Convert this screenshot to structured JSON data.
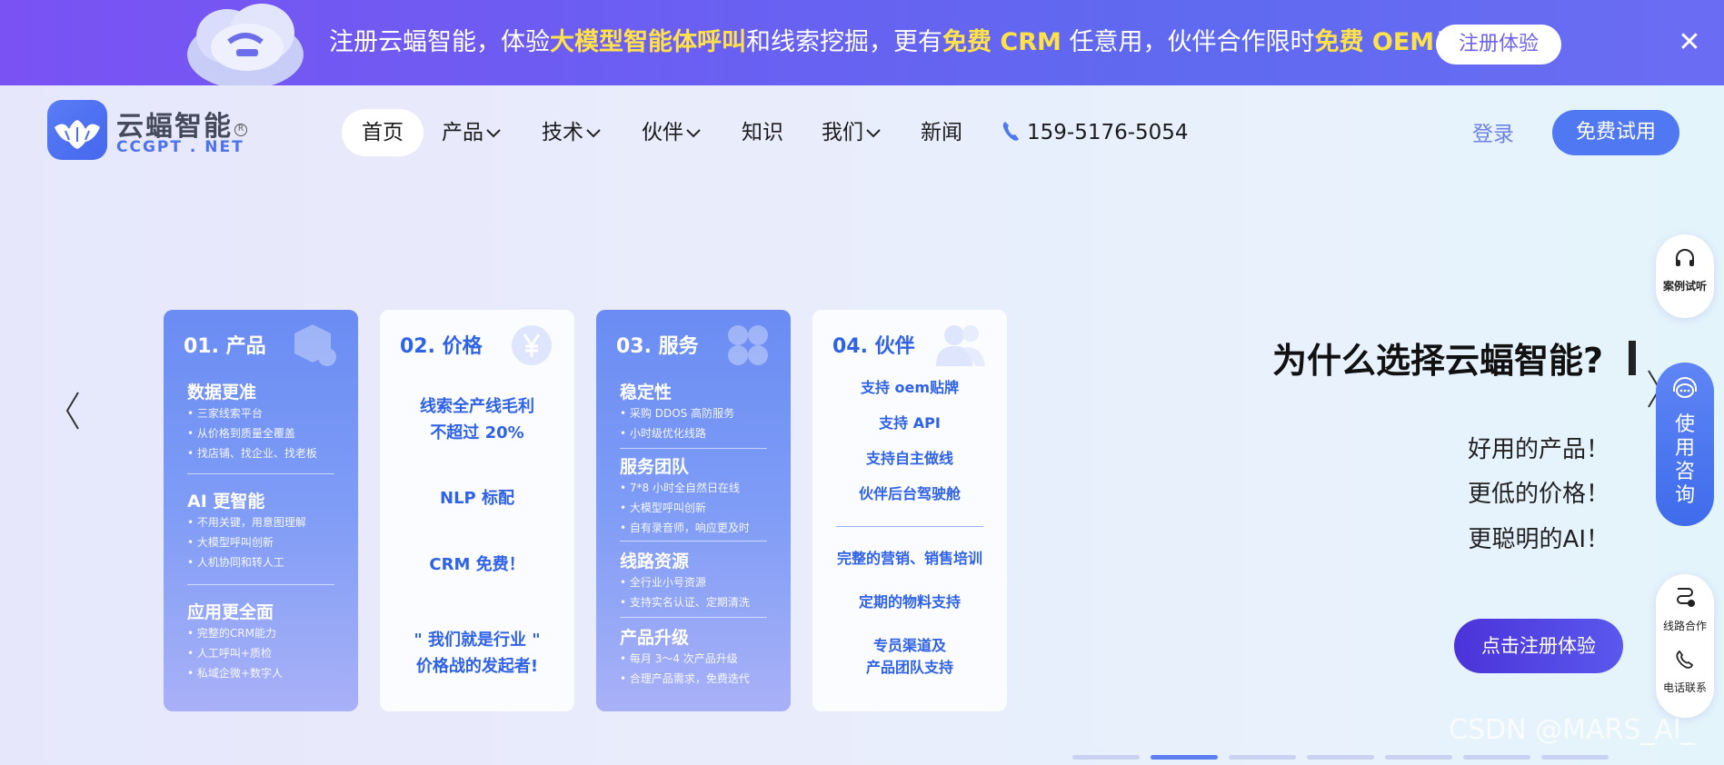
{
  "banner": {
    "segments": [
      {
        "text": "注册云蝠智能，体验",
        "hl": false
      },
      {
        "text": "大模型智能体呼叫",
        "hl": true
      },
      {
        "text": "和线索挖掘，更有",
        "hl": false
      },
      {
        "text": "免费 CRM",
        "hl": true
      },
      {
        "text": " 任意用，伙伴合作限时",
        "hl": false
      },
      {
        "text": "免费 OEM",
        "hl": true
      },
      {
        "text": "！",
        "hl": false
      }
    ],
    "button_label": "注册体验",
    "close_glyph": "✕"
  },
  "logo": {
    "name": "云蝠智能",
    "sub": "CCGPT . NET",
    "registered": "R"
  },
  "nav": {
    "items": [
      {
        "label": "首页",
        "dropdown": false
      },
      {
        "label": "产品",
        "dropdown": true
      },
      {
        "label": "技术",
        "dropdown": true
      },
      {
        "label": "伙伴",
        "dropdown": true
      },
      {
        "label": "知识",
        "dropdown": false
      },
      {
        "label": "我们",
        "dropdown": true
      },
      {
        "label": "新闻",
        "dropdown": false
      }
    ],
    "phone": "159-5176-5054",
    "login": "登录",
    "trial": "免费试用"
  },
  "cards": {
    "product": {
      "title": "01. 产品",
      "icon": "box-gear-icon",
      "sections": [
        {
          "heading": "数据更准",
          "items": [
            "三家线索平台",
            "从价格到质量全覆盖",
            "找店铺、找企业、找老板"
          ]
        },
        {
          "heading": "AI 更智能",
          "items": [
            "不用关键，用意图理解",
            "大模型呼叫创新",
            "人机协同和转人工"
          ]
        },
        {
          "heading": "应用更全面",
          "items": [
            "完整的CRM能力",
            "人工呼叫+质检",
            "私域企微+数字人"
          ]
        }
      ]
    },
    "price": {
      "title": "02. 价格",
      "icon": "yen-icon",
      "line1a": "线索全产线毛利",
      "line1b": "不超过 20%",
      "line2": "NLP 标配",
      "line3": "CRM 免费！",
      "quote_a": "\"  我们就是行业  \"",
      "quote_b": "价格战的发起者!"
    },
    "service": {
      "title": "03. 服务",
      "icon": "clover-icon",
      "sections": [
        {
          "heading": "稳定性",
          "items": [
            "采购 DDOS 高防服务",
            "小时级优化线路"
          ]
        },
        {
          "heading": "服务团队",
          "items": [
            "7*8 小时全自然日在线",
            "大模型呼叫创新",
            "自有录音师，响应更及时"
          ]
        },
        {
          "heading": "线路资源",
          "items": [
            "全行业小号资源",
            "支持实名认证、定期清洗"
          ]
        },
        {
          "heading": "产品升级",
          "items": [
            "每月 3～4 次产品升级",
            "合理产品需求，免费迭代"
          ]
        }
      ]
    },
    "partner": {
      "title": "04. 伙伴",
      "icon": "people-icon",
      "lines_top": [
        "支持 oem贴牌",
        "支持 API",
        "支持自主做线",
        "伙伴后台驾驶舱"
      ],
      "lines_bottom": [
        "完整的营销、销售培训",
        "定期的物料支持"
      ],
      "last_a": "专员渠道及",
      "last_b": "产品团队支持"
    }
  },
  "hero": {
    "title": "为什么选择云蝠智能?",
    "lines": [
      "好用的产品！",
      "更低的价格！",
      "更聪明的AI！"
    ],
    "cta": "点击注册体验"
  },
  "side": {
    "case": "案例试听",
    "consult": "使用咨询",
    "line_coop": "线路合作",
    "phone_contact": "电话联系"
  },
  "carousel": {
    "slides": 7,
    "active_index": 1
  },
  "watermark": "CSDN @MARS_AI_",
  "colors": {
    "banner_bg": "#6a5ff2",
    "highlight": "#ffe14a",
    "accent": "#4f78f2",
    "card_blue": "#6a8cf3",
    "card_text_blue": "#2f62e7"
  }
}
